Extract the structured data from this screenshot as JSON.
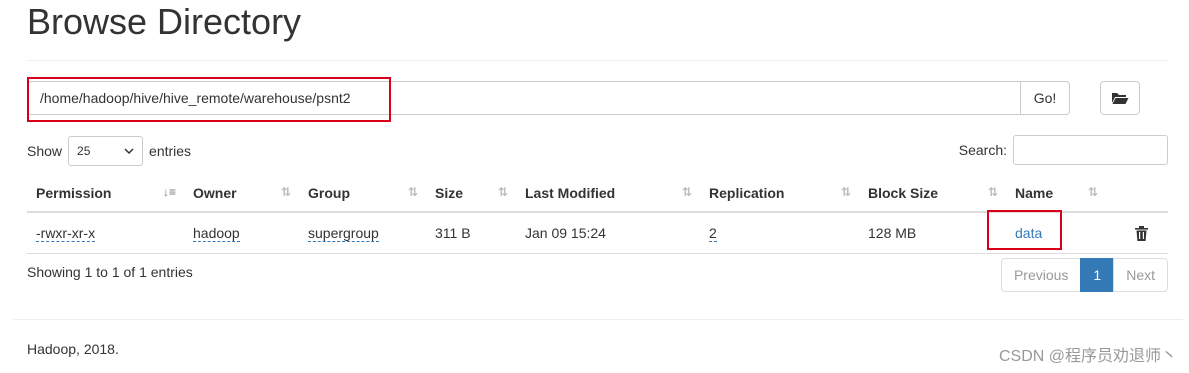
{
  "page": {
    "title": "Browse Directory"
  },
  "path_bar": {
    "value": "/home/hadoop/hive/hive_remote/warehouse/psnt2",
    "go_label": "Go!",
    "folder_icon": "folder-open-icon"
  },
  "controls": {
    "show_label": "Show",
    "entries_value": "25",
    "entries_label": "entries",
    "search_label": "Search:"
  },
  "table": {
    "columns": [
      "Permission",
      "Owner",
      "Group",
      "Size",
      "Last Modified",
      "Replication",
      "Block Size",
      "Name"
    ],
    "rows": [
      {
        "permission": "-rwxr-xr-x",
        "owner": "hadoop",
        "group": "supergroup",
        "size": "311 B",
        "modified": "Jan 09 15:24",
        "replication": "2",
        "block_size": "128 MB",
        "name": "data"
      }
    ]
  },
  "info": {
    "showing": "Showing 1 to 1 of 1 entries"
  },
  "pagination": {
    "previous": "Previous",
    "current": "1",
    "next": "Next"
  },
  "footer": {
    "text": "Hadoop, 2018."
  },
  "watermark": {
    "text": "CSDN @程序员劝退师丶"
  },
  "colors": {
    "link": "#337ab7",
    "highlight": "#d9001b",
    "active_page": "#337ab7"
  }
}
